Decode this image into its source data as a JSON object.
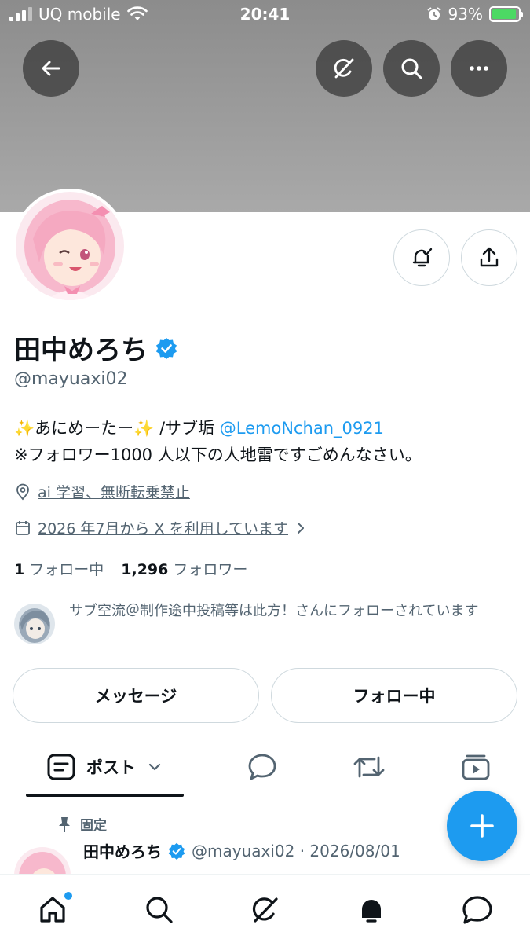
{
  "status": {
    "carrier": "UQ mobile",
    "time": "20:41",
    "battery": "93%",
    "battery_level": 0.93
  },
  "header": {
    "back_icon": "arrow-left-icon",
    "grok_icon": "grok-icon",
    "search_icon": "search-icon",
    "more_icon": "more-horizontal-icon"
  },
  "profile": {
    "display_name": "田中めろち",
    "handle": "@mayuaxi02",
    "bio_line1_pre": "✨あにめーたー✨ /サブ垢 ",
    "bio_line1_link": "@LemoNchan_0921",
    "bio_line2": "※フォロワー1000 人以下の人地雷ですごめんなさい。",
    "location": "ai 学習、無断転乗禁止",
    "joined": "2026 年7月から X を利用しています",
    "following_count": "1",
    "following_label": "フォロー中",
    "followers_count": "1,296",
    "followers_label": "フォロワー",
    "followed_by": "サブ空流＠制作途中投稿等は此方！さんにフォローされています"
  },
  "actions": {
    "message": "メッセージ",
    "following": "フォロー中"
  },
  "tabs": {
    "posts": "ポスト"
  },
  "pinned_post": {
    "pinned_label": "固定",
    "name": "田中めろち",
    "meta": "@mayuaxi02 · 2026/08/01"
  },
  "colors": {
    "accent": "#1d9bf0",
    "text": "#0f1419",
    "muted": "#536471",
    "border": "#cfd9de"
  }
}
